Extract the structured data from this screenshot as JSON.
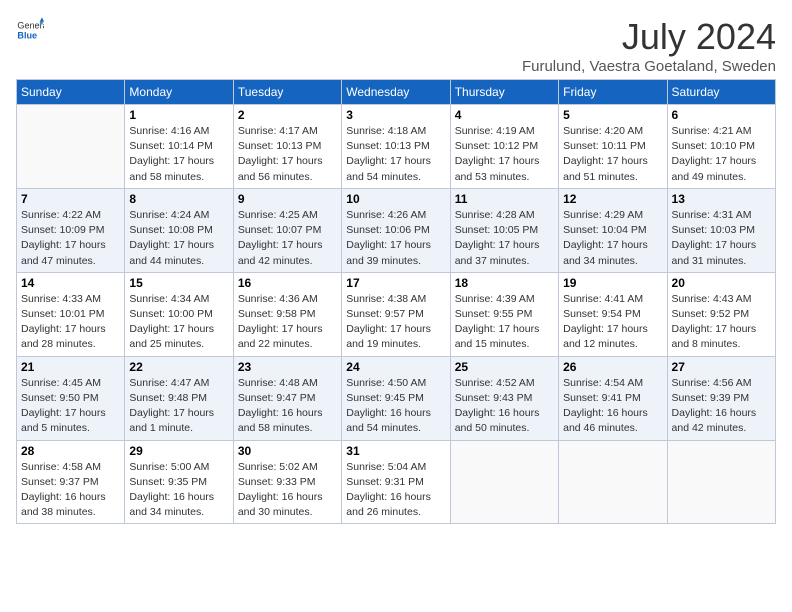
{
  "header": {
    "logo_general": "General",
    "logo_blue": "Blue",
    "title": "July 2024",
    "location": "Furulund, Vaestra Goetaland, Sweden"
  },
  "days_of_week": [
    "Sunday",
    "Monday",
    "Tuesday",
    "Wednesday",
    "Thursday",
    "Friday",
    "Saturday"
  ],
  "weeks": [
    [
      {
        "day": "",
        "info": ""
      },
      {
        "day": "1",
        "info": "Sunrise: 4:16 AM\nSunset: 10:14 PM\nDaylight: 17 hours\nand 58 minutes."
      },
      {
        "day": "2",
        "info": "Sunrise: 4:17 AM\nSunset: 10:13 PM\nDaylight: 17 hours\nand 56 minutes."
      },
      {
        "day": "3",
        "info": "Sunrise: 4:18 AM\nSunset: 10:13 PM\nDaylight: 17 hours\nand 54 minutes."
      },
      {
        "day": "4",
        "info": "Sunrise: 4:19 AM\nSunset: 10:12 PM\nDaylight: 17 hours\nand 53 minutes."
      },
      {
        "day": "5",
        "info": "Sunrise: 4:20 AM\nSunset: 10:11 PM\nDaylight: 17 hours\nand 51 minutes."
      },
      {
        "day": "6",
        "info": "Sunrise: 4:21 AM\nSunset: 10:10 PM\nDaylight: 17 hours\nand 49 minutes."
      }
    ],
    [
      {
        "day": "7",
        "info": "Sunrise: 4:22 AM\nSunset: 10:09 PM\nDaylight: 17 hours\nand 47 minutes."
      },
      {
        "day": "8",
        "info": "Sunrise: 4:24 AM\nSunset: 10:08 PM\nDaylight: 17 hours\nand 44 minutes."
      },
      {
        "day": "9",
        "info": "Sunrise: 4:25 AM\nSunset: 10:07 PM\nDaylight: 17 hours\nand 42 minutes."
      },
      {
        "day": "10",
        "info": "Sunrise: 4:26 AM\nSunset: 10:06 PM\nDaylight: 17 hours\nand 39 minutes."
      },
      {
        "day": "11",
        "info": "Sunrise: 4:28 AM\nSunset: 10:05 PM\nDaylight: 17 hours\nand 37 minutes."
      },
      {
        "day": "12",
        "info": "Sunrise: 4:29 AM\nSunset: 10:04 PM\nDaylight: 17 hours\nand 34 minutes."
      },
      {
        "day": "13",
        "info": "Sunrise: 4:31 AM\nSunset: 10:03 PM\nDaylight: 17 hours\nand 31 minutes."
      }
    ],
    [
      {
        "day": "14",
        "info": "Sunrise: 4:33 AM\nSunset: 10:01 PM\nDaylight: 17 hours\nand 28 minutes."
      },
      {
        "day": "15",
        "info": "Sunrise: 4:34 AM\nSunset: 10:00 PM\nDaylight: 17 hours\nand 25 minutes."
      },
      {
        "day": "16",
        "info": "Sunrise: 4:36 AM\nSunset: 9:58 PM\nDaylight: 17 hours\nand 22 minutes."
      },
      {
        "day": "17",
        "info": "Sunrise: 4:38 AM\nSunset: 9:57 PM\nDaylight: 17 hours\nand 19 minutes."
      },
      {
        "day": "18",
        "info": "Sunrise: 4:39 AM\nSunset: 9:55 PM\nDaylight: 17 hours\nand 15 minutes."
      },
      {
        "day": "19",
        "info": "Sunrise: 4:41 AM\nSunset: 9:54 PM\nDaylight: 17 hours\nand 12 minutes."
      },
      {
        "day": "20",
        "info": "Sunrise: 4:43 AM\nSunset: 9:52 PM\nDaylight: 17 hours\nand 8 minutes."
      }
    ],
    [
      {
        "day": "21",
        "info": "Sunrise: 4:45 AM\nSunset: 9:50 PM\nDaylight: 17 hours\nand 5 minutes."
      },
      {
        "day": "22",
        "info": "Sunrise: 4:47 AM\nSunset: 9:48 PM\nDaylight: 17 hours\nand 1 minute."
      },
      {
        "day": "23",
        "info": "Sunrise: 4:48 AM\nSunset: 9:47 PM\nDaylight: 16 hours\nand 58 minutes."
      },
      {
        "day": "24",
        "info": "Sunrise: 4:50 AM\nSunset: 9:45 PM\nDaylight: 16 hours\nand 54 minutes."
      },
      {
        "day": "25",
        "info": "Sunrise: 4:52 AM\nSunset: 9:43 PM\nDaylight: 16 hours\nand 50 minutes."
      },
      {
        "day": "26",
        "info": "Sunrise: 4:54 AM\nSunset: 9:41 PM\nDaylight: 16 hours\nand 46 minutes."
      },
      {
        "day": "27",
        "info": "Sunrise: 4:56 AM\nSunset: 9:39 PM\nDaylight: 16 hours\nand 42 minutes."
      }
    ],
    [
      {
        "day": "28",
        "info": "Sunrise: 4:58 AM\nSunset: 9:37 PM\nDaylight: 16 hours\nand 38 minutes."
      },
      {
        "day": "29",
        "info": "Sunrise: 5:00 AM\nSunset: 9:35 PM\nDaylight: 16 hours\nand 34 minutes."
      },
      {
        "day": "30",
        "info": "Sunrise: 5:02 AM\nSunset: 9:33 PM\nDaylight: 16 hours\nand 30 minutes."
      },
      {
        "day": "31",
        "info": "Sunrise: 5:04 AM\nSunset: 9:31 PM\nDaylight: 16 hours\nand 26 minutes."
      },
      {
        "day": "",
        "info": ""
      },
      {
        "day": "",
        "info": ""
      },
      {
        "day": "",
        "info": ""
      }
    ]
  ]
}
